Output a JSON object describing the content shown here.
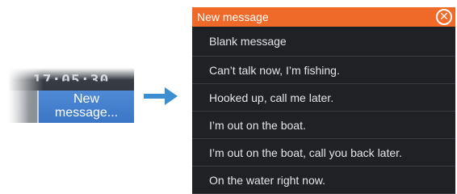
{
  "left_crop": {
    "time_text": "17:05:30",
    "button_line1": "New",
    "button_line2": "message..."
  },
  "arrow": {
    "color": "#3b8fd1",
    "icon": "arrow-right-icon"
  },
  "dialog": {
    "title": "New message",
    "header_color": "#ef6a28",
    "close_icon": "close-circle-icon",
    "close_glyph": "✕",
    "messages": [
      "Blank message",
      "Can’t talk now, I’m fishing.",
      "Hooked up, call me later.",
      "I’m out on the boat.",
      "I’m out on the boat, call you back later.",
      "On the water right now."
    ]
  }
}
